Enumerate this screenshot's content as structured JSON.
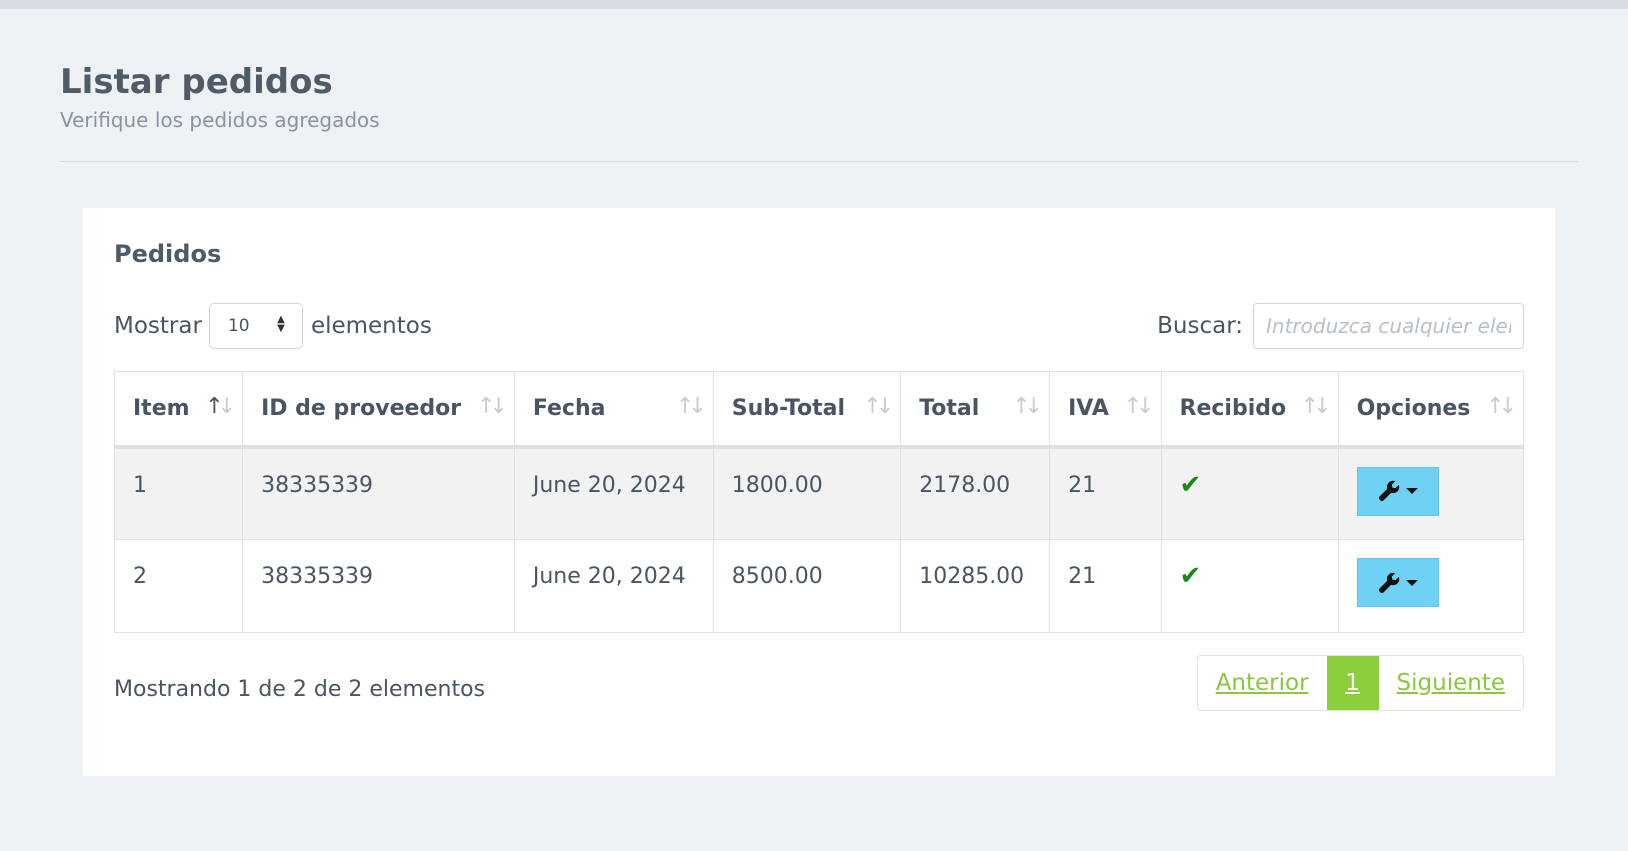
{
  "header": {
    "title": "Listar pedidos",
    "subtitle": "Verifique los pedidos agregados"
  },
  "card": {
    "title": "Pedidos"
  },
  "length": {
    "prefix": "Mostrar",
    "value": "10",
    "suffix": "elementos"
  },
  "search": {
    "label": "Buscar:",
    "placeholder": "Introduzca cualquier elemento"
  },
  "table": {
    "columns": [
      "Item",
      "ID de proveedor",
      "Fecha",
      "Sub-Total",
      "Total",
      "IVA",
      "Recibido",
      "Opciones"
    ],
    "sort_active_column": "Item",
    "rows": [
      {
        "item": "1",
        "proveedor": "38335339",
        "fecha": "June 20, 2024",
        "subtotal": "1800.00",
        "total": "2178.00",
        "iva": "21",
        "recibido": true
      },
      {
        "item": "2",
        "proveedor": "38335339",
        "fecha": "June 20, 2024",
        "subtotal": "8500.00",
        "total": "10285.00",
        "iva": "21",
        "recibido": true
      }
    ]
  },
  "info": "Mostrando 1 de 2 de 2 elementos",
  "pagination": {
    "previous": "Anterior",
    "current": "1",
    "next": "Siguiente"
  },
  "icons": {
    "check": "check-icon",
    "options": "wrench-icon",
    "sort": "sort-icon"
  },
  "colors": {
    "accent_green": "#8ccf3c",
    "options_button": "#6fd2f5",
    "check": "#178a17"
  }
}
